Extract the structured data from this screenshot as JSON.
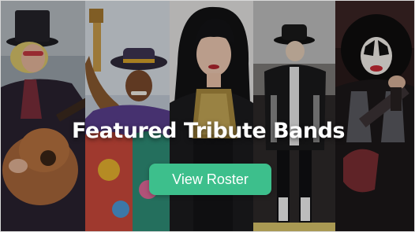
{
  "banner": {
    "headline": "Featured Tribute Bands",
    "cta_label": "View Roster"
  },
  "colors": {
    "cta_background": "#3dbf8c",
    "headline_text": "#ffffff"
  },
  "photos": [
    {
      "name": "guitarist-in-top-hat-photo"
    },
    {
      "name": "guitarist-in-colorful-hat-photo"
    },
    {
      "name": "singer-with-bangs-photo"
    },
    {
      "name": "performer-in-fedora-photo"
    },
    {
      "name": "performer-in-face-paint-photo"
    }
  ]
}
